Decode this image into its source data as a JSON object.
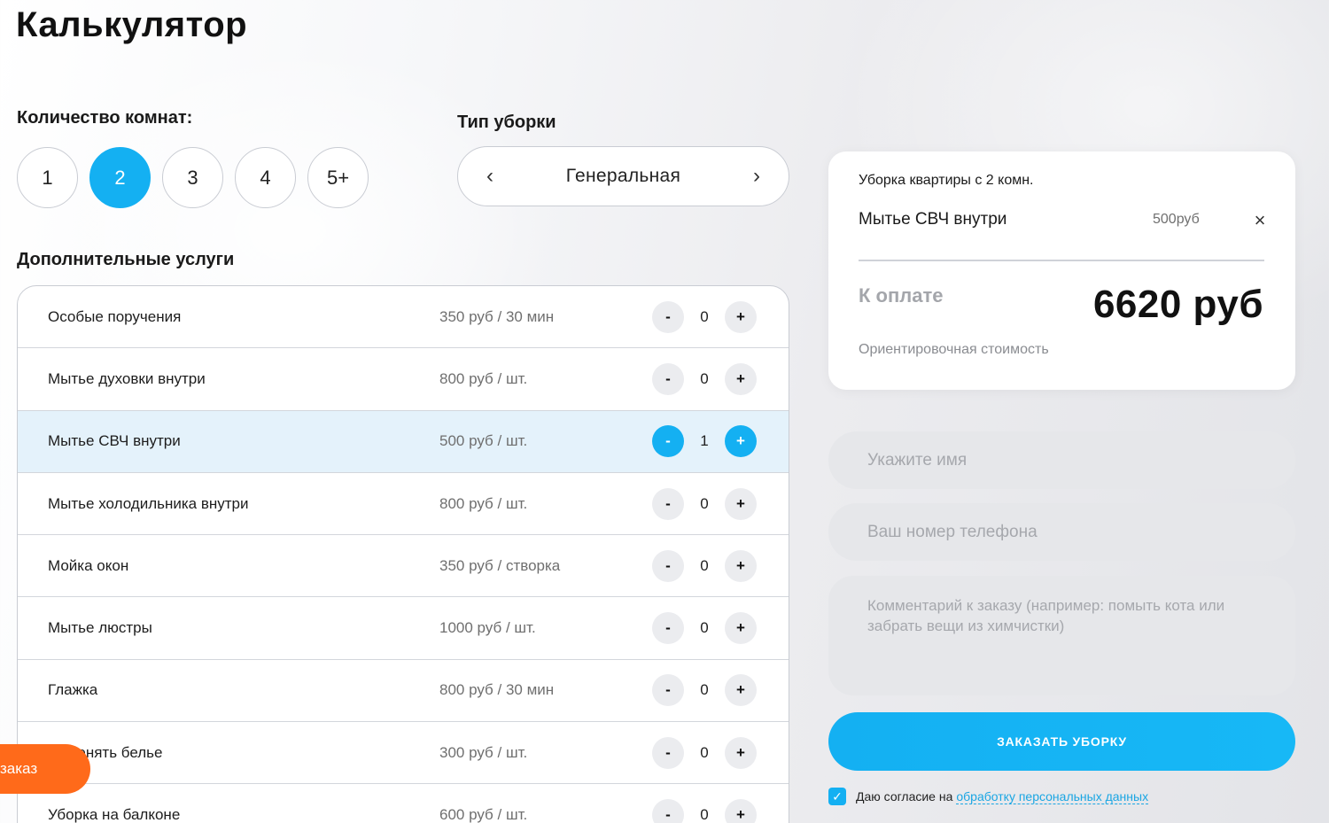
{
  "title": "Калькулятор",
  "rooms": {
    "label": "Количество комнат:",
    "options": [
      "1",
      "2",
      "3",
      "4",
      "5+"
    ],
    "selected": "2"
  },
  "cleaning_type": {
    "label": "Тип уборки",
    "value": "Генеральная",
    "prev_icon": "chevron-left-icon",
    "next_icon": "chevron-right-icon"
  },
  "extras": {
    "label": "Дополнительные услуги",
    "items": [
      {
        "name": "Особые поручения",
        "price": "350 руб / 30 мин",
        "qty": "0"
      },
      {
        "name": "Мытье духовки внутри",
        "price": "800 руб / шт.",
        "qty": "0"
      },
      {
        "name": "Мытье СВЧ внутри",
        "price": "500 руб / шт.",
        "qty": "1"
      },
      {
        "name": "Мытье холодильника внутри",
        "price": "800 руб / шт.",
        "qty": "0"
      },
      {
        "name": "Мойка окон",
        "price": "350 руб / створка",
        "qty": "0"
      },
      {
        "name": "Мытье люстры",
        "price": "1000 руб / шт.",
        "qty": "0"
      },
      {
        "name": "Глажка",
        "price": "800 руб / 30 мин",
        "qty": "0"
      },
      {
        "name": "Поменять белье",
        "price": "300 руб / шт.",
        "qty": "0"
      },
      {
        "name": "Уборка на балконе",
        "price": "600 руб / шт.",
        "qty": "0"
      }
    ],
    "minus_label": "-",
    "plus_label": "+"
  },
  "summary": {
    "title": "Уборка квартиры с 2 комн.",
    "item_name": "Мытье СВЧ внутри",
    "item_price": "500руб",
    "remove_icon": "close-icon",
    "pay_label": "К оплате",
    "total": "6620 руб",
    "note": "Ориентировочная стоимость"
  },
  "form": {
    "name_placeholder": "Укажите имя",
    "phone_placeholder": "Ваш номер телефона",
    "comment_placeholder": "Комментарий к заказу (например: помыть кота или забрать вещи из химчистки)",
    "submit_label": "ЗАКАЗАТЬ УБОРКУ",
    "consent_text": "Даю согласие на",
    "consent_link": "обработку персональных данных",
    "consent_checked": true
  },
  "floating_button": {
    "label": "заказ"
  },
  "colors": {
    "accent": "#14b0f2",
    "floating": "#ff6a1a"
  }
}
